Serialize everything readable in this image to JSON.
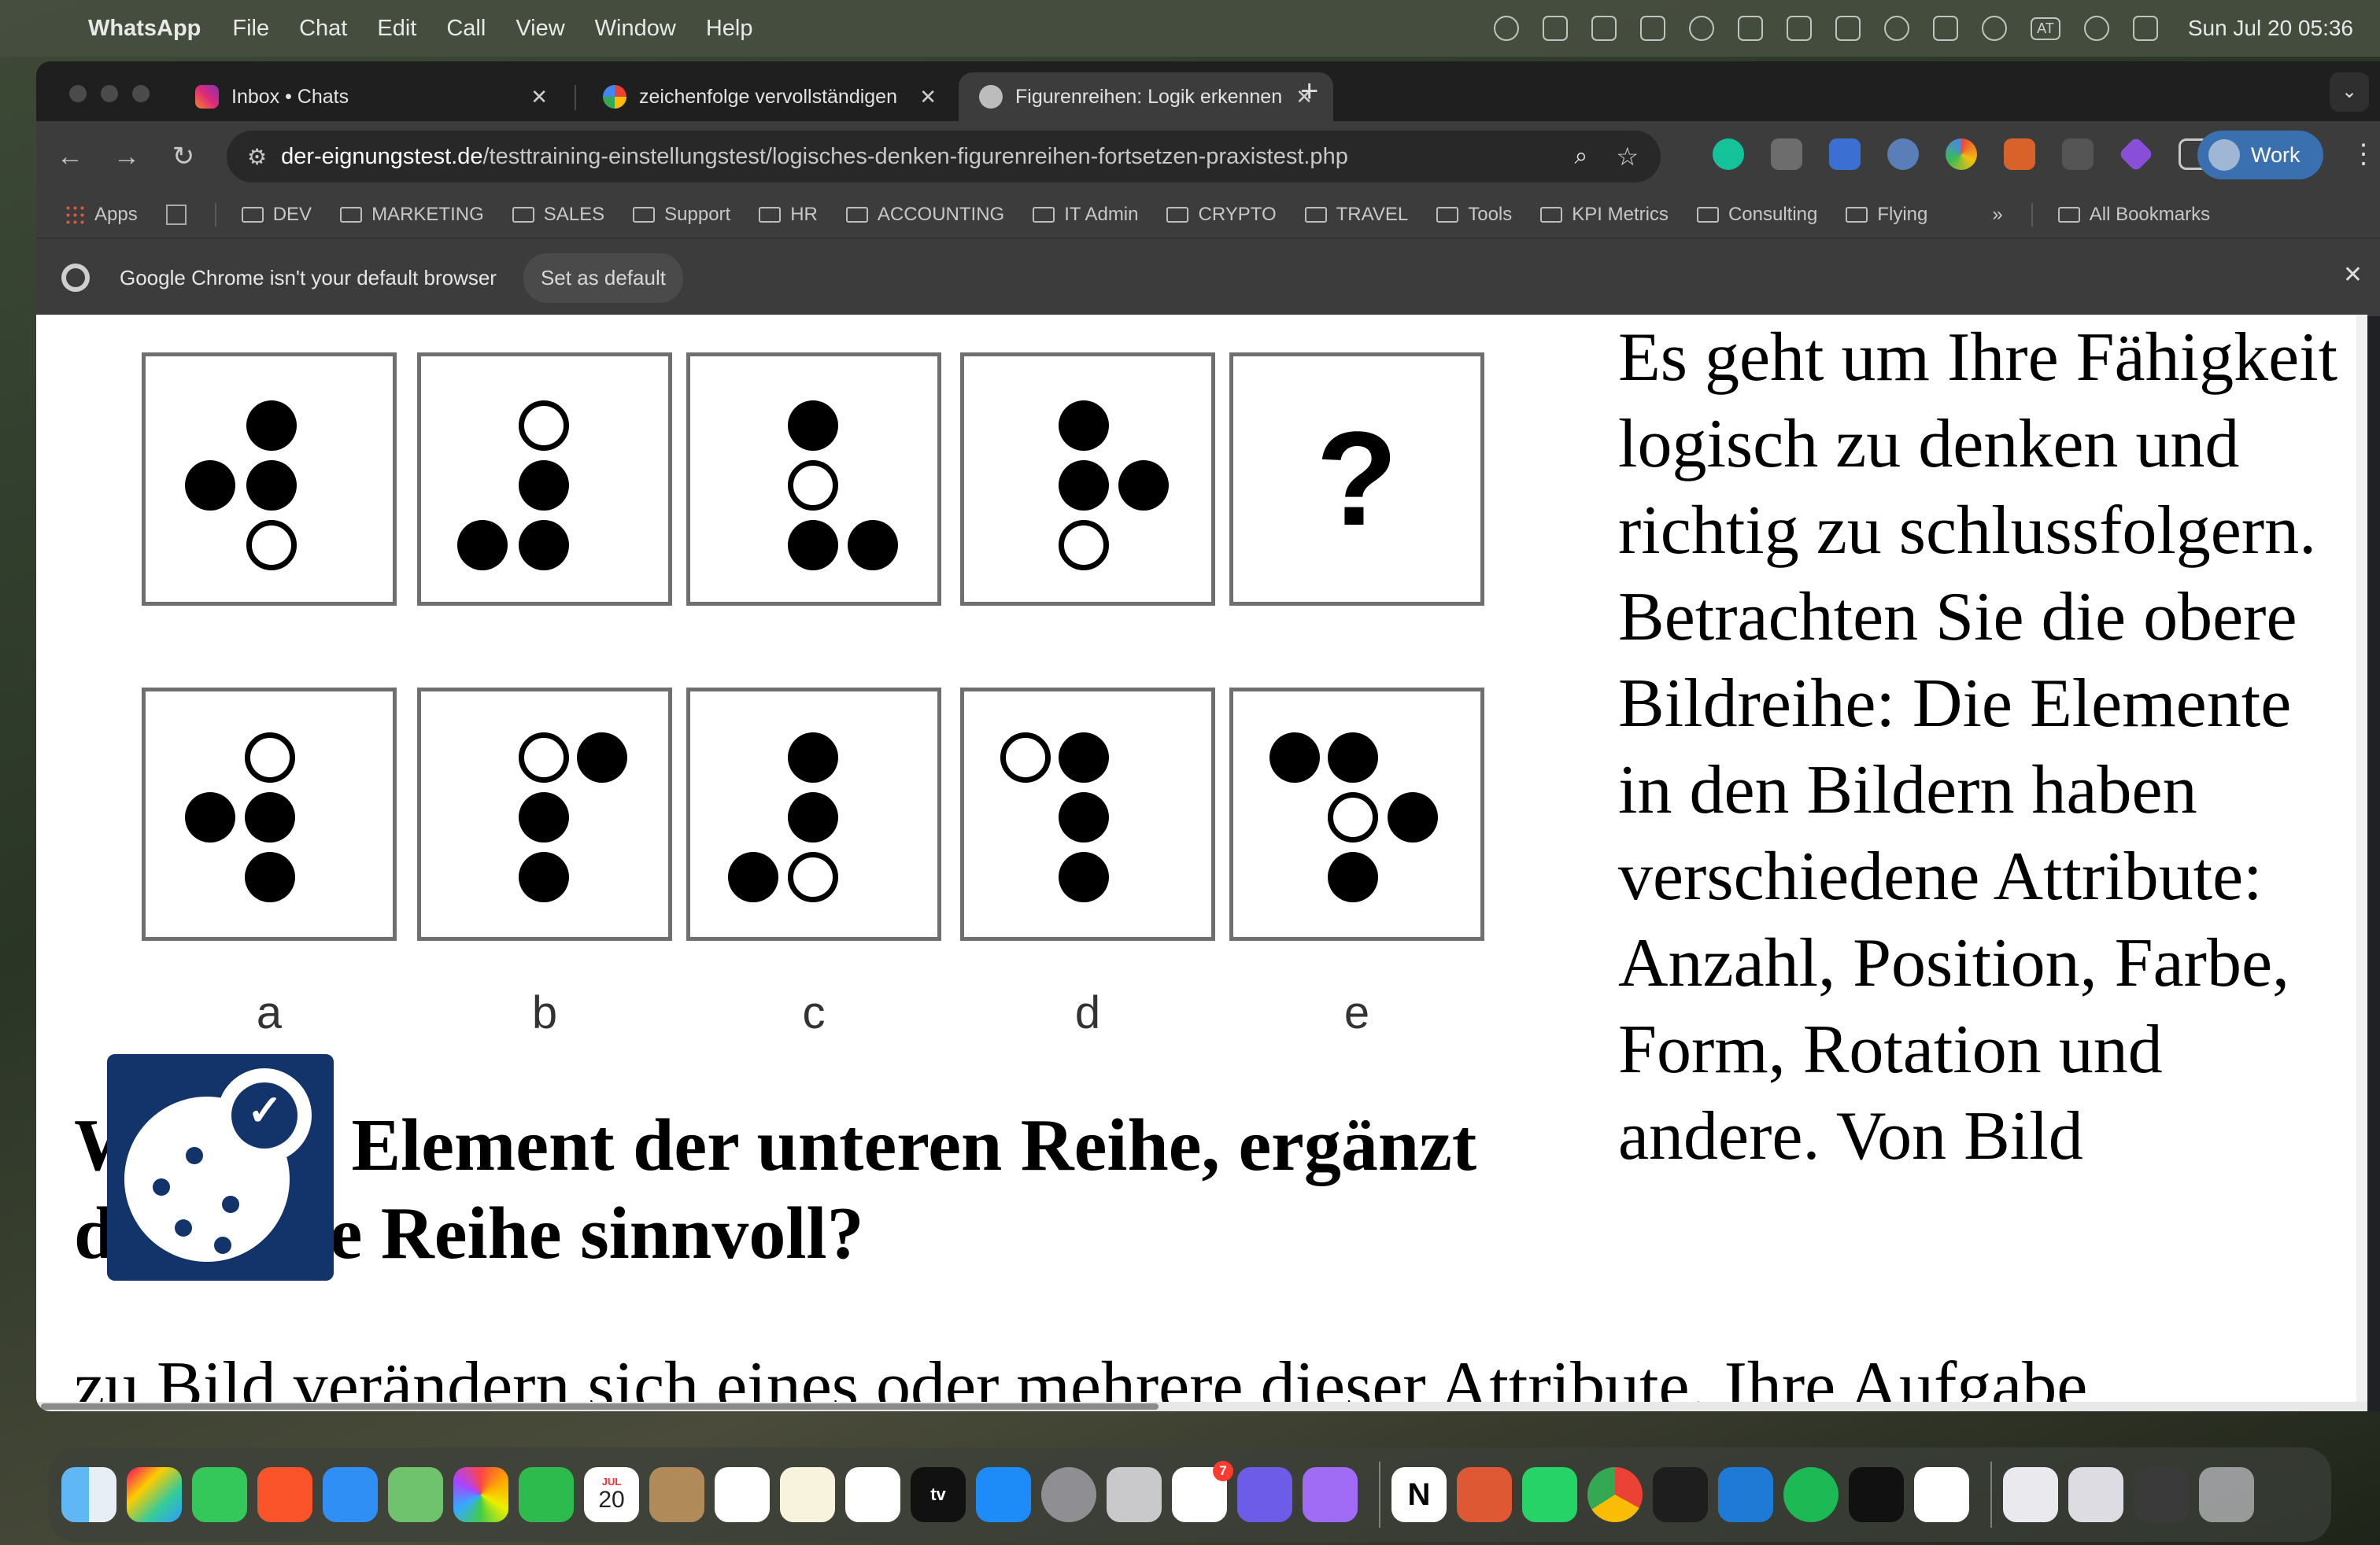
{
  "menubar": {
    "app_name": "WhatsApp",
    "menus": [
      "File",
      "Chat",
      "Edit",
      "Call",
      "View",
      "Window",
      "Help"
    ],
    "status_icons": [
      "openai-icon",
      "layers-icon",
      "grammarly-icon",
      "notion-icon",
      "globe-icon",
      "checkmark-icon",
      "briefcase-icon",
      "layout-icon",
      "play-icon",
      "battery-icon",
      "wifi-icon",
      "keyboard-input-icon",
      "search-icon",
      "control-center-icon"
    ],
    "keyboard_layout": "AT",
    "clock": "Sun Jul 20  05:36"
  },
  "browser": {
    "tabs": [
      {
        "title": "Inbox • Chats",
        "favicon": "instagram-icon",
        "active": false
      },
      {
        "title": "zeichenfolge vervollständigen",
        "favicon": "google-icon",
        "active": false
      },
      {
        "title": "Figurenreihen: Logik erkennen",
        "favicon": "globe-icon",
        "active": true
      }
    ],
    "url_domain": "der-eignungstest.de",
    "url_path": "/testtraining-einstellungstest/logisches-denken-figurenreihen-fortsetzen-praxistest.php",
    "profile_label": "Work",
    "bookmarks": [
      "Apps",
      "DEV",
      "MARKETING",
      "SALES",
      "Support",
      "HR",
      "ACCOUNTING",
      "IT Admin",
      "CRYPTO",
      "TRAVEL",
      "Tools",
      "KPI Metrics",
      "Consulting",
      "Flying"
    ],
    "bookmarks_overflow": "»",
    "all_bookmarks": "All Bookmarks",
    "infobar": {
      "message": "Google Chrome isn't your default browser",
      "button": "Set as default"
    }
  },
  "page": {
    "top_row": [
      "figure-1",
      "figure-2",
      "figure-3",
      "figure-4",
      "?"
    ],
    "answer_letters": [
      "a",
      "b",
      "c",
      "d",
      "e"
    ],
    "question": "Welches Element der unteren Reihe, ergänzt die obere Reihe sinnvoll?",
    "side_text": "Es geht um Ihre Fähigkeit logisch zu denken und richtig zu schlussfolgern. Betrachten Sie die obere Bildreihe: Die Elemente in den Bildern haben verschiedene Attribute: Anzahl, Position, Farbe, Form, Rotation und andere. Von Bild",
    "cut_text": "zu Bild verändern sich eines oder mehrere dieser Attribute. Ihre Aufgabe"
  },
  "dock": {
    "apps": [
      "Finder",
      "Launchpad",
      "Messages",
      "Brave",
      "Mail",
      "Maps",
      "Photos",
      "FaceTime",
      "Calendar",
      "Contacts",
      "Reminders",
      "Notes",
      "Freeform",
      "TV",
      "App Store",
      "System Settings",
      "iPhone Mirroring",
      "Spark",
      "Prompt",
      "Mail Extension",
      "Notion",
      "DuckDuckGo",
      "WhatsApp",
      "Chrome",
      "Terminal",
      "VS Code",
      "Spotify",
      "Activity Monitor",
      "ChatGPT",
      "Documents",
      "Files",
      "Downloads",
      "Trash"
    ],
    "calendar_month": "JUL",
    "calendar_day": "20",
    "spark_badge": "7"
  },
  "colors": {
    "menubar": "#464e40",
    "tab_active": "#3c3c3c",
    "profile": "#3a6fb0",
    "cookie_badge": "#13336b"
  }
}
